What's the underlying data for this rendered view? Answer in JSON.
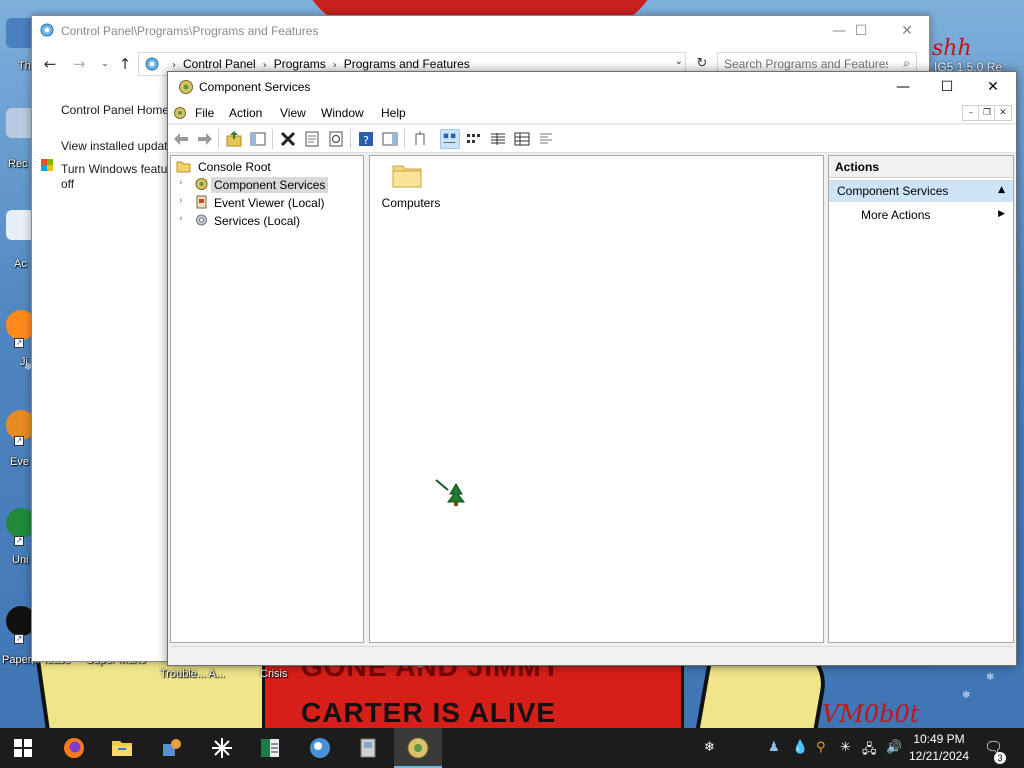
{
  "desktop": {
    "icon_labels": [
      "Th",
      "Rec",
      "Ac",
      "Ji",
      "Eve",
      "Uni",
      "Paper, Please",
      "Super Mario",
      "Trouble... A...",
      "Crisis"
    ],
    "wallpaper": {
      "sign_line_1": "GONE AND JIMMY",
      "sign_line_2": "CARTER IS ALIVE",
      "signature": "VM0b0t",
      "top_right_scrawl": "shh",
      "top_right_text": "IG5 1.5.0 Re"
    }
  },
  "control_panel": {
    "title": "Control Panel\\Programs\\Programs and Features",
    "breadcrumbs": [
      "Control Panel",
      "Programs",
      "Programs and Features"
    ],
    "search_placeholder": "Search Programs and Features",
    "left_links": {
      "home": "Control Panel Home",
      "updates": "View installed updates",
      "features_1": "Turn Windows features on or",
      "features_2": "off"
    },
    "caption": {
      "minimize": "—",
      "maximize": "☐",
      "close": "✕"
    }
  },
  "component_services": {
    "title": "Component Services",
    "menu": [
      "File",
      "Action",
      "View",
      "Window",
      "Help"
    ],
    "caption": {
      "minimize": "—",
      "maximize": "☐",
      "close": "✕"
    },
    "mdi": {
      "minimize": "–",
      "restore": "❐",
      "close": "✕"
    },
    "tree": {
      "root": "Console Root",
      "items": [
        "Component Services",
        "Event Viewer (Local)",
        "Services (Local)"
      ],
      "selected_index": 0
    },
    "content": {
      "items": [
        "Computers"
      ]
    },
    "actions": {
      "header": "Actions",
      "section": "Component Services",
      "more": "More Actions"
    }
  },
  "taskbar": {
    "time": "10:49 PM",
    "date": "12/21/2024",
    "notification_count": "3"
  },
  "colors": {
    "accent": "#76b9ed",
    "selection": "#cde3f6",
    "taskbar": "#1c1c1c"
  }
}
